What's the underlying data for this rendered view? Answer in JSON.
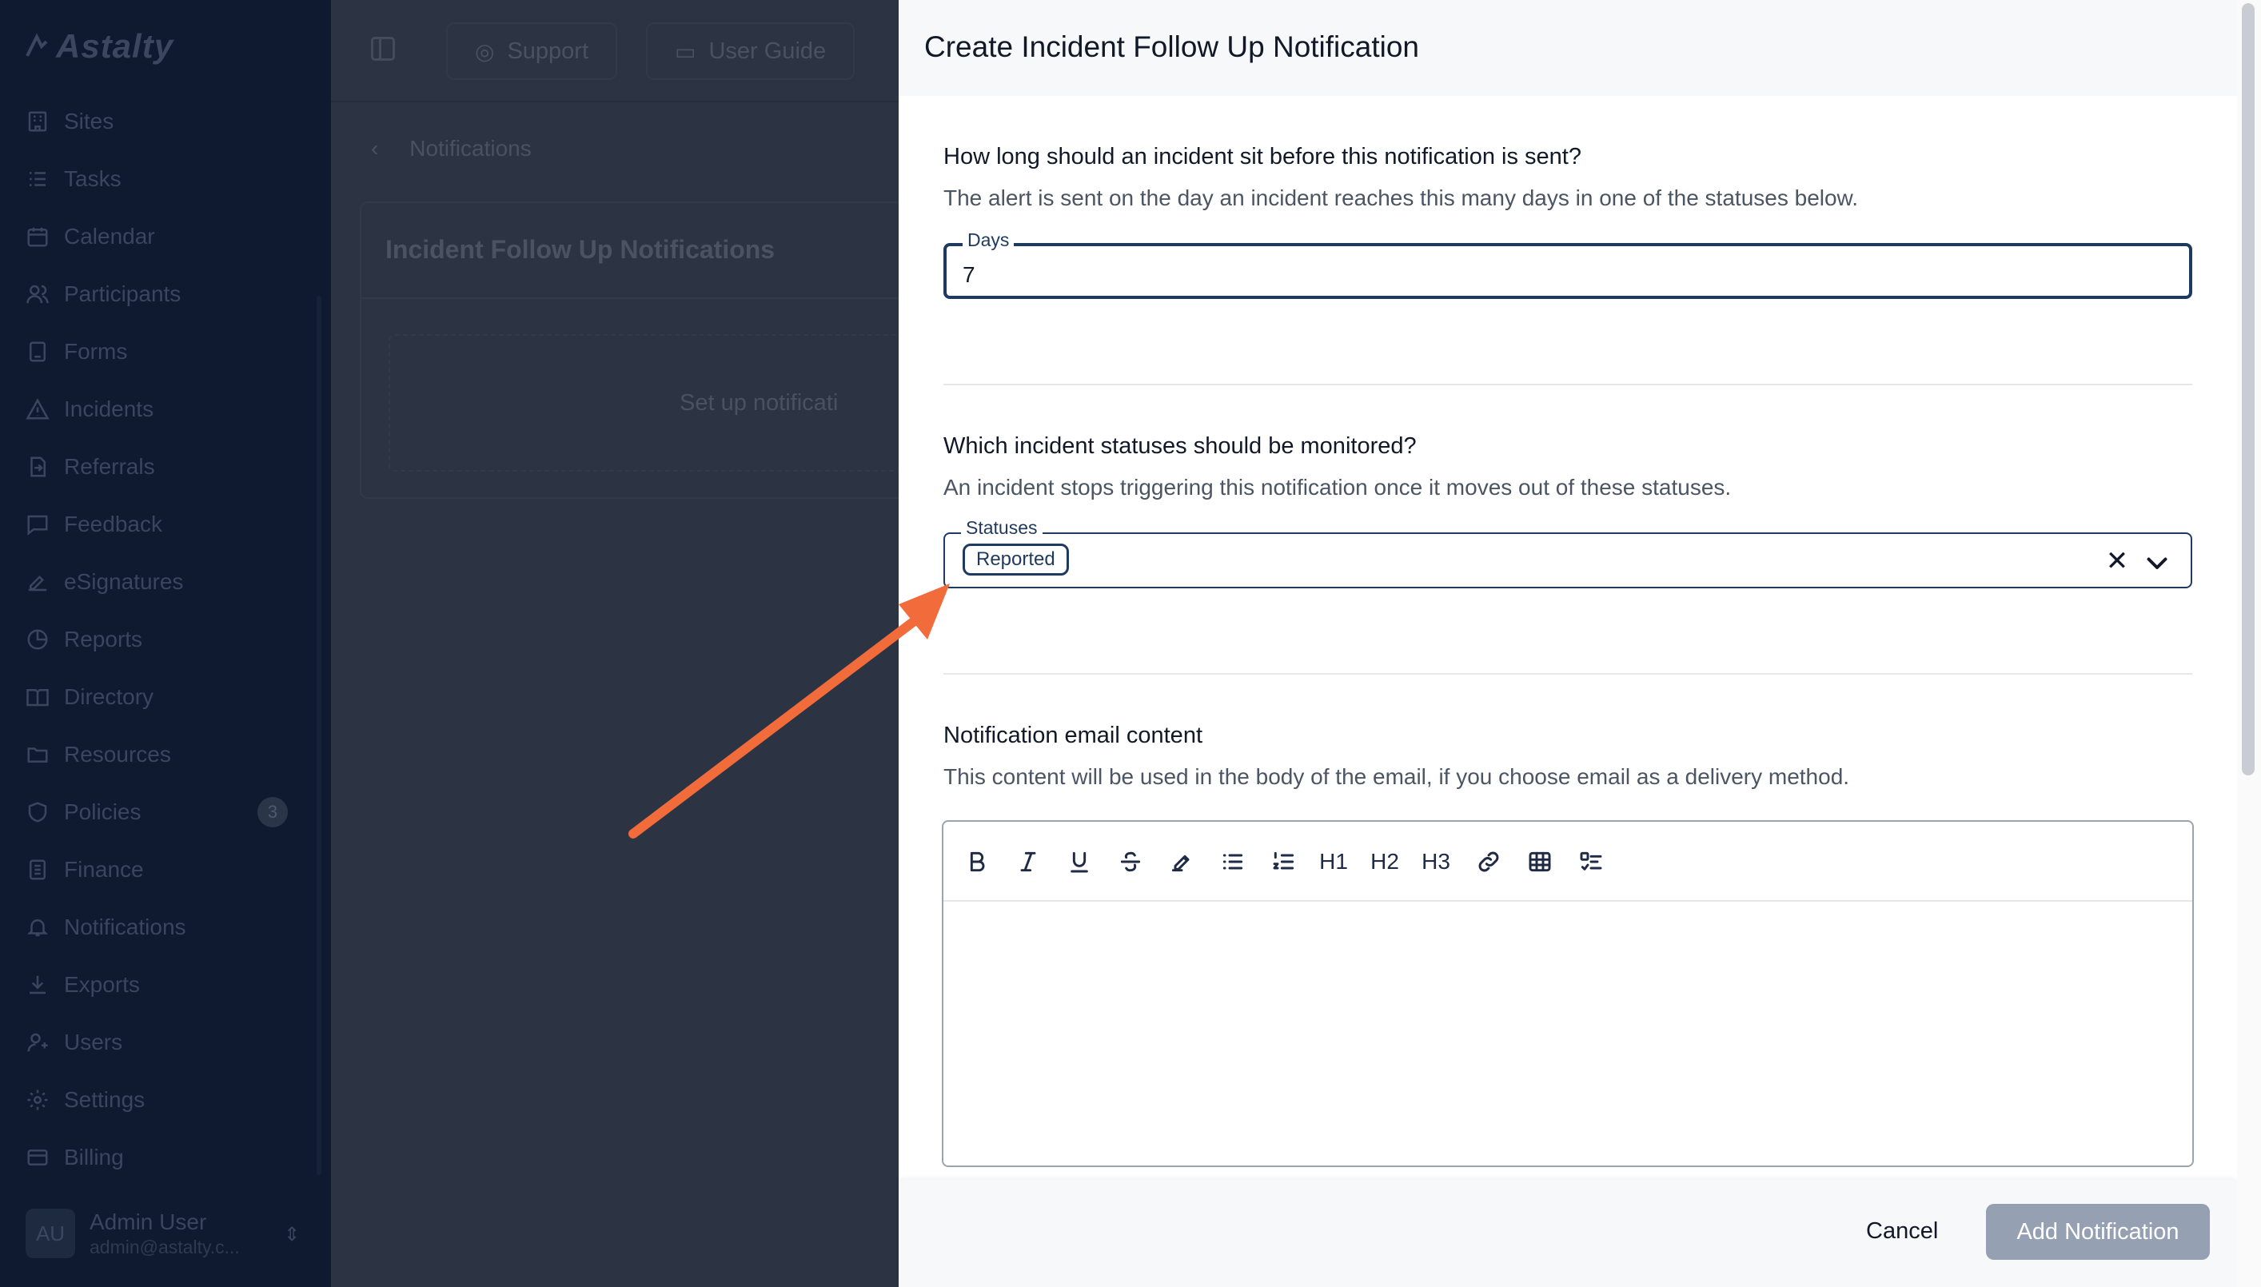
{
  "app": {
    "logo_text": "Astalty"
  },
  "sidebar": {
    "items": [
      {
        "label": "Sites",
        "icon": "building-icon"
      },
      {
        "label": "Tasks",
        "icon": "tasks-icon"
      },
      {
        "label": "Calendar",
        "icon": "calendar-icon"
      },
      {
        "label": "Participants",
        "icon": "users-icon"
      },
      {
        "label": "Forms",
        "icon": "forms-icon"
      },
      {
        "label": "Incidents",
        "icon": "warning-icon"
      },
      {
        "label": "Referrals",
        "icon": "referral-icon"
      },
      {
        "label": "Feedback",
        "icon": "feedback-icon"
      },
      {
        "label": "eSignatures",
        "icon": "signature-icon"
      },
      {
        "label": "Reports",
        "icon": "reports-icon"
      },
      {
        "label": "Directory",
        "icon": "directory-icon"
      },
      {
        "label": "Resources",
        "icon": "folder-icon"
      },
      {
        "label": "Policies",
        "icon": "shield-icon",
        "badge": "3"
      },
      {
        "label": "Finance",
        "icon": "finance-icon"
      },
      {
        "label": "Notifications",
        "icon": "bell-icon"
      },
      {
        "label": "Exports",
        "icon": "download-icon"
      },
      {
        "label": "Users",
        "icon": "user-icon"
      },
      {
        "label": "Settings",
        "icon": "gear-icon"
      },
      {
        "label": "Billing",
        "icon": "card-icon"
      }
    ],
    "user": {
      "initials": "AU",
      "name": "Admin User",
      "email": "admin@astalty.c..."
    }
  },
  "topbar": {
    "support_label": "Support",
    "guide_label": "User Guide"
  },
  "background": {
    "breadcrumb": "Notifications",
    "card_title": "Incident Follow Up Notifications",
    "empty_text": "Set up notificati"
  },
  "modal": {
    "title": "Create Incident Follow Up Notification",
    "days_section": {
      "question": "How long should an incident sit before this notification is sent?",
      "description": "The alert is sent on the day an incident reaches this many days in one of the statuses below.",
      "field_label": "Days",
      "field_value": "7"
    },
    "status_section": {
      "question": "Which incident statuses should be monitored?",
      "description": "An incident stops triggering this notification once it moves out of these statuses.",
      "field_label": "Statuses",
      "selected": [
        "Reported"
      ]
    },
    "email_section": {
      "question": "Notification email content",
      "description": "This content will be used in the body of the email, if you choose email as a delivery method.",
      "toolbar": [
        "bold",
        "italic",
        "underline",
        "strikethrough",
        "highlight",
        "bullet-list",
        "ordered-list",
        "H1",
        "H2",
        "H3",
        "link",
        "table",
        "task-list"
      ],
      "h1_label": "H1",
      "h2_label": "H2",
      "h3_label": "H3"
    },
    "footer": {
      "cancel_label": "Cancel",
      "submit_label": "Add Notification"
    }
  },
  "colors": {
    "accent": "#1f3a5f",
    "annotation_arrow": "#f26b3a",
    "sidebar_bg": "#0f1a30",
    "submit_disabled": "#95a0b3"
  }
}
